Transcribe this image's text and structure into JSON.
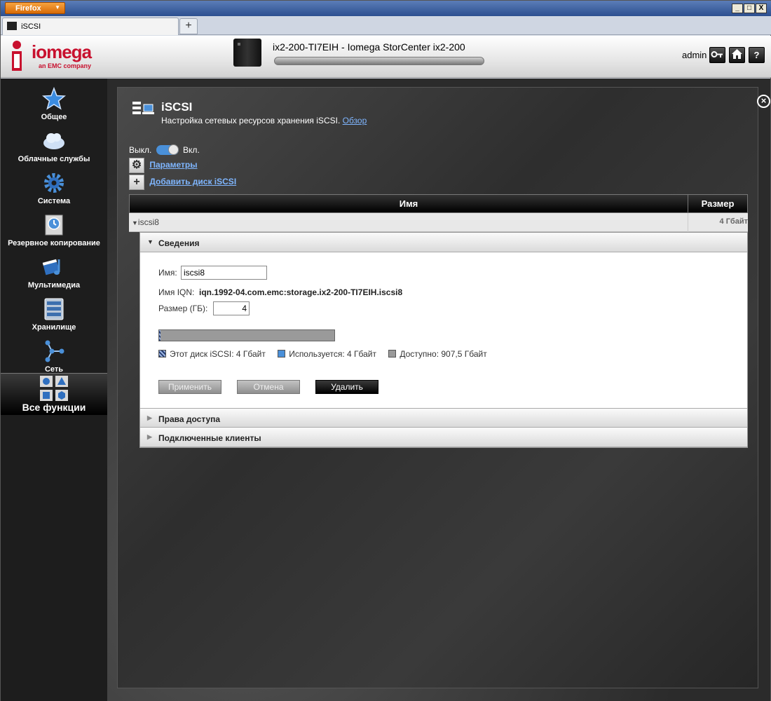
{
  "browser": {
    "menu_label": "Firefox",
    "tab_title": "iSCSI",
    "new_tab": "+",
    "window_controls": [
      "_",
      "□",
      "X"
    ]
  },
  "header": {
    "logo_text": "iomega",
    "logo_sub": "an EMC company",
    "device_title": "ix2-200-TI7EIH - Iomega StorCenter ix2-200",
    "user": "admin",
    "icons": [
      "key-icon",
      "home-icon",
      "help-icon"
    ],
    "help_glyph": "?"
  },
  "nav": {
    "items": [
      {
        "label": "Общее",
        "icon": "star-icon"
      },
      {
        "label": "Облачные службы",
        "icon": "cloud-icon"
      },
      {
        "label": "Система",
        "icon": "gear-icon"
      },
      {
        "label": "Резервное копирование",
        "icon": "backup-icon"
      },
      {
        "label": "Мультимедиа",
        "icon": "multimedia-icon"
      },
      {
        "label": "Хранилище",
        "icon": "storage-icon"
      },
      {
        "label": "Сеть",
        "icon": "network-icon"
      }
    ],
    "all_functions": "Все функции"
  },
  "page": {
    "title": "iSCSI",
    "subtitle": "Настройка сетевых ресурсов хранения iSCSI.",
    "overview_link": "Обзор",
    "toggle_off": "Выкл.",
    "toggle_on": "Вкл.",
    "settings_link": "Параметры",
    "add_disk_link": "Добавить диск iSCSI",
    "close_glyph": "×"
  },
  "table": {
    "col_name": "Имя",
    "col_size": "Размер",
    "row": {
      "name": "iscsi8",
      "size": "4 Гбайт"
    }
  },
  "details": {
    "section_title": "Сведения",
    "name_label": "Имя:",
    "name_value": "iscsi8",
    "iqn_label": "Имя IQN:",
    "iqn_value": "iqn.1992-04.com.emc:storage.ix2-200-TI7EIH.iscsi8",
    "size_label": "Размер (ГБ):",
    "size_value": "4",
    "usage_fraction": 0.004,
    "legend": [
      {
        "label": "Этот диск iSCSI: 4 Гбайт",
        "color": "#223a6e"
      },
      {
        "label": "Используется: 4 Гбайт",
        "color": "#4a90d9"
      },
      {
        "label": "Доступно: 907,5 Гбайт",
        "color": "#9a9a9a"
      }
    ],
    "apply_button": "Применить",
    "cancel_button": "Отмена",
    "delete_button": "Удалить",
    "access_rights": "Права доступа",
    "connected_clients": "Подключенные клиенты"
  }
}
